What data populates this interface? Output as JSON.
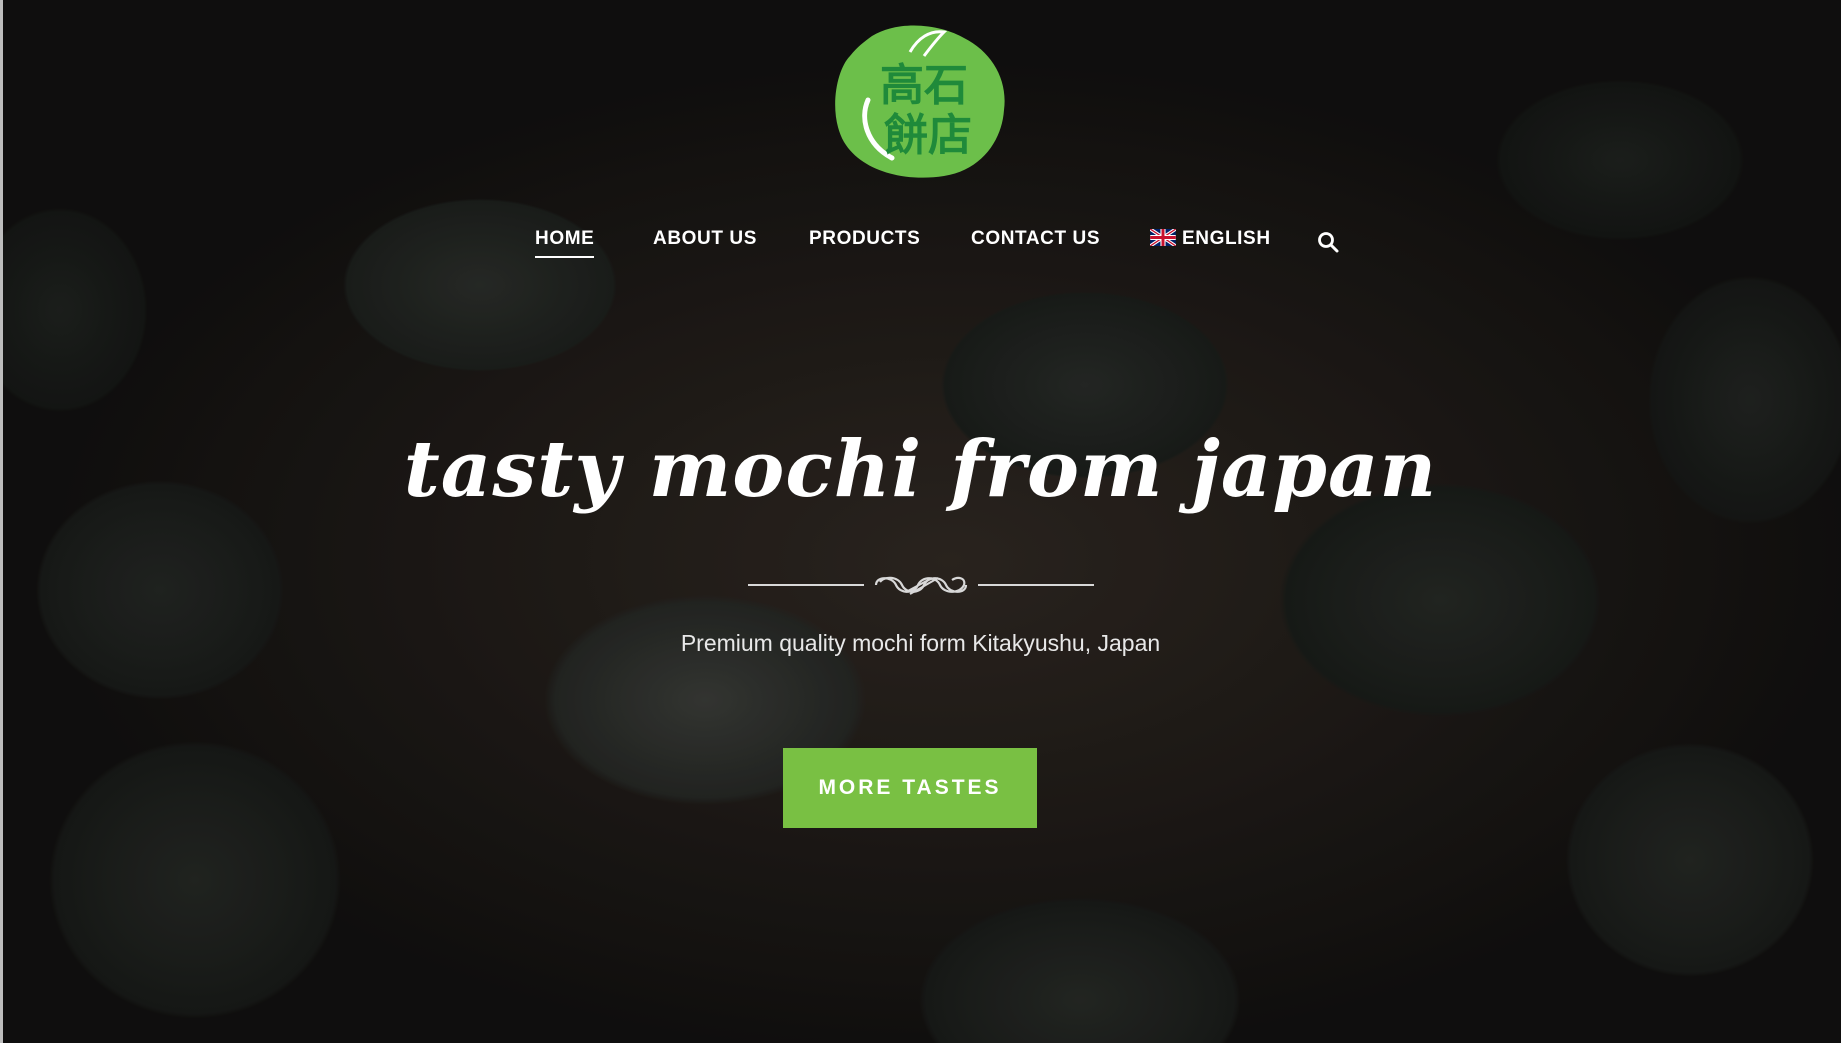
{
  "logo": {
    "text_line1": "高石",
    "text_line2": "餅店",
    "color_green": "#6cbf4a",
    "color_dark_green": "#1f8a3a"
  },
  "nav": {
    "items": [
      {
        "label": "HOME",
        "active": true
      },
      {
        "label": "ABOUT US",
        "active": false
      },
      {
        "label": "PRODUCTS",
        "active": false
      },
      {
        "label": "CONTACT US",
        "active": false
      }
    ],
    "language": {
      "label": "ENGLISH",
      "icon": "uk-flag-icon"
    },
    "search_icon": "search-icon"
  },
  "hero": {
    "headline": "tasty mochi from japan",
    "ornament_icon": "flourish-divider-icon",
    "subtitle": "Premium quality mochi form Kitakyushu, Japan",
    "cta_label": "MORE TASTES",
    "cta_color": "#79c043"
  }
}
